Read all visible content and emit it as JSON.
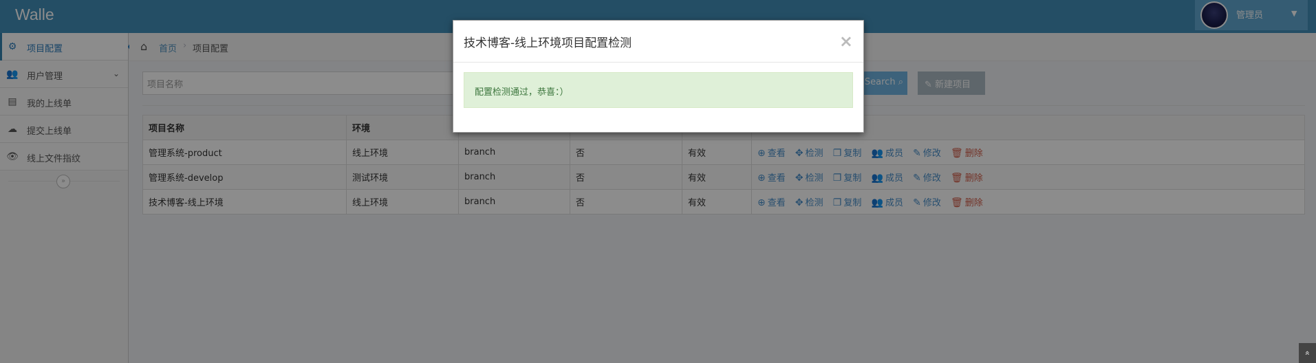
{
  "app": {
    "brand": "Walle"
  },
  "user": {
    "name": "管理员",
    "caret": "▼"
  },
  "sidebar": {
    "items": [
      {
        "label": "项目配置",
        "icon": "⚙"
      },
      {
        "label": "用户管理",
        "icon": "👥"
      },
      {
        "label": "我的上线单",
        "icon": "▤"
      },
      {
        "label": "提交上线单",
        "icon": "☁"
      },
      {
        "label": "线上文件指纹",
        "icon": "👁"
      }
    ],
    "submenu_arrow": "⌄",
    "collapse_glyph": "»"
  },
  "breadcrumb": {
    "home": "首页",
    "separator": "›",
    "current": "项目配置"
  },
  "search": {
    "placeholder": "项目名称",
    "button_label": "Search",
    "new_label": "新建项目"
  },
  "table": {
    "headers": [
      "项目名称",
      "环境",
      "",
      "",
      "",
      ""
    ],
    "rows": [
      {
        "name": "管理系统-product",
        "env": "线上环境",
        "branch": "branch",
        "flag": "否",
        "status": "有效"
      },
      {
        "name": "管理系统-develop",
        "env": "测试环境",
        "branch": "branch",
        "flag": "否",
        "status": "有效"
      },
      {
        "name": "技术博客-线上环境",
        "env": "线上环境",
        "branch": "branch",
        "flag": "否",
        "status": "有效"
      }
    ],
    "actions": {
      "view": "查看",
      "check": "检测",
      "copy": "复制",
      "members": "成员",
      "edit": "修改",
      "delete": "删除"
    }
  },
  "modal": {
    "title": "技术博客-线上环境项目配置检测",
    "close": "×",
    "message": "配置检测通过，恭喜：）"
  },
  "colors": {
    "navbar": "#438eb9",
    "accent": "#2b7dbc",
    "success_bg": "#dff0d8",
    "danger": "#d15b47"
  },
  "scroll_top_glyph": "»"
}
